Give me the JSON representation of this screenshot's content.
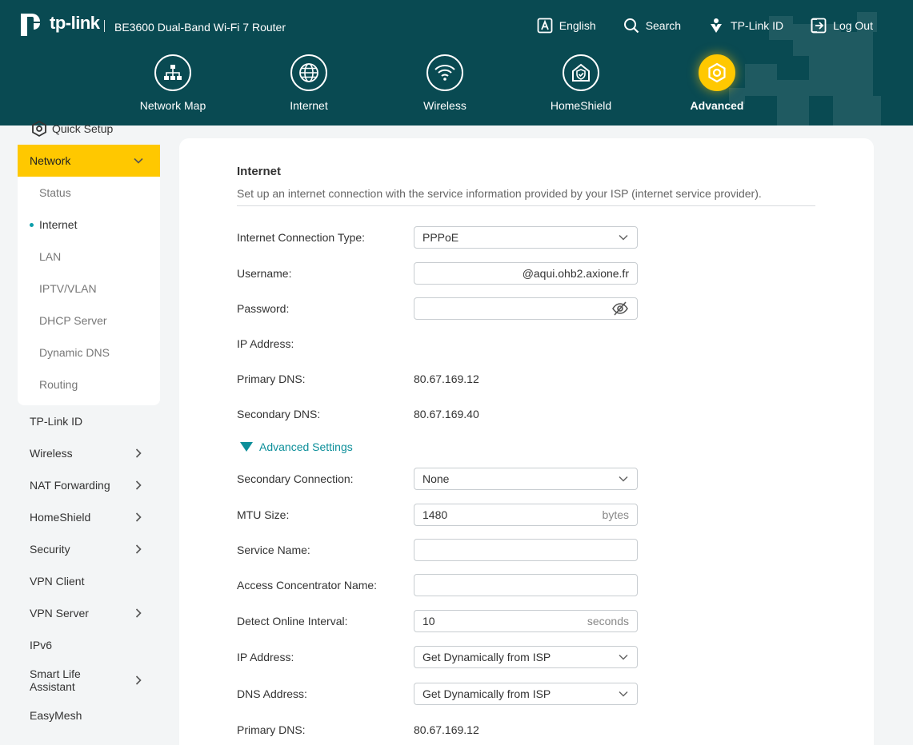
{
  "header": {
    "brand": "tp-link",
    "model": "BE3600 Dual-Band Wi-Fi 7 Router",
    "top_links": [
      {
        "label": "English",
        "icon": "language-icon"
      },
      {
        "label": "Search",
        "icon": "search-icon"
      },
      {
        "label": "TP-Link ID",
        "icon": "tplink-id-icon"
      },
      {
        "label": "Log Out",
        "icon": "logout-icon"
      }
    ],
    "main_nav": [
      {
        "label": "Network Map",
        "icon": "network-map-icon",
        "active": false
      },
      {
        "label": "Internet",
        "icon": "globe-icon",
        "active": false
      },
      {
        "label": "Wireless",
        "icon": "wifi-icon",
        "active": false
      },
      {
        "label": "HomeShield",
        "icon": "homeshield-icon",
        "active": false
      },
      {
        "label": "Advanced",
        "icon": "gear-icon",
        "active": true
      }
    ]
  },
  "sidebar": {
    "quick_setup": "Quick Setup",
    "network": {
      "label": "Network",
      "items": [
        "Status",
        "Internet",
        "LAN",
        "IPTV/VLAN",
        "DHCP Server",
        "Dynamic DNS",
        "Routing"
      ],
      "active": "Internet"
    },
    "items": [
      {
        "label": "TP-Link ID",
        "expand": false
      },
      {
        "label": "Wireless",
        "expand": true
      },
      {
        "label": "NAT Forwarding",
        "expand": true
      },
      {
        "label": "HomeShield",
        "expand": true
      },
      {
        "label": "Security",
        "expand": true
      },
      {
        "label": "VPN Client",
        "expand": false
      },
      {
        "label": "VPN Server",
        "expand": true
      },
      {
        "label": "IPv6",
        "expand": false
      },
      {
        "label": "Smart Life Assistant",
        "expand": true
      },
      {
        "label": "EasyMesh",
        "expand": false
      }
    ]
  },
  "main": {
    "title": "Internet",
    "description": "Set up an internet connection with the service information provided by your ISP (internet service provider).",
    "connection_type_label": "Internet Connection Type:",
    "connection_type_value": "PPPoE",
    "username_label": "Username:",
    "username_value": "@aqui.ohb2.axione.fr",
    "password_label": "Password:",
    "password_value": "",
    "ip_address_label": "IP Address:",
    "ip_address_value": "",
    "primary_dns_label": "Primary DNS:",
    "primary_dns_value": "80.67.169.12",
    "secondary_dns_label": "Secondary DNS:",
    "secondary_dns_value": "80.67.169.40",
    "advanced_settings": "Advanced Settings",
    "secondary_connection_label": "Secondary Connection:",
    "secondary_connection_value": "None",
    "mtu_label": "MTU Size:",
    "mtu_value": "1480",
    "mtu_unit": "bytes",
    "service_name_label": "Service Name:",
    "service_name_value": "",
    "access_concentrator_label": "Access Concentrator Name:",
    "access_concentrator_value": "",
    "detect_interval_label": "Detect Online Interval:",
    "detect_interval_value": "10",
    "detect_interval_unit": "seconds",
    "adv_ip_label": "IP Address:",
    "adv_ip_value": "Get Dynamically from ISP",
    "dns_address_label": "DNS Address:",
    "dns_address_value": "Get Dynamically from ISP",
    "adv_primary_dns_label": "Primary DNS:",
    "adv_primary_dns_value": "80.67.169.12"
  },
  "colors": {
    "header_bg": "#094a52",
    "accent_yellow": "#ffc800",
    "link_teal": "#0d8f9a"
  }
}
